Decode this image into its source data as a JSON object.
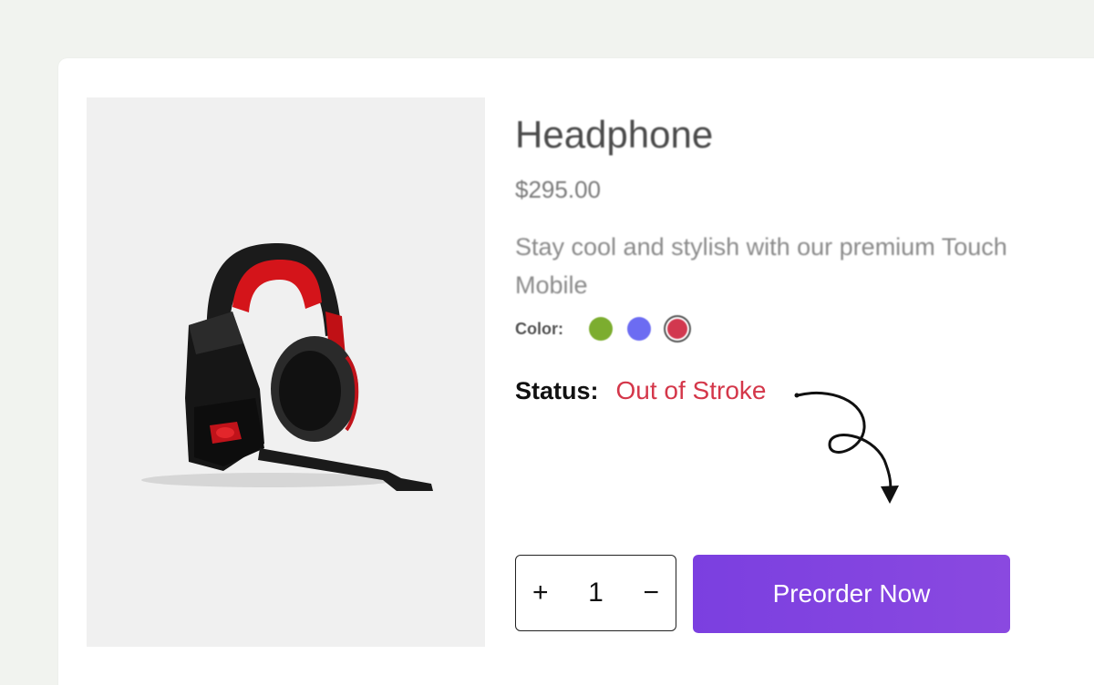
{
  "product": {
    "title": "Headphone",
    "price": "$295.00",
    "description": "Stay cool and stylish with our premium Touch Mobile",
    "image_icon": "headphone-product-image"
  },
  "color": {
    "label": "Color:",
    "swatches": [
      {
        "name": "green",
        "hex": "#7cad2f",
        "selected": false
      },
      {
        "name": "blue",
        "hex": "#6c6cf2",
        "selected": false
      },
      {
        "name": "red",
        "hex": "#d2384f",
        "selected": true
      }
    ]
  },
  "status": {
    "label": "Status:",
    "value": "Out of Stroke",
    "value_color": "#d4374a"
  },
  "quantity": {
    "plus": "+",
    "value": "1",
    "minus": "−"
  },
  "preorder": {
    "label": "Preorder Now",
    "color": "#7b3fe0"
  }
}
